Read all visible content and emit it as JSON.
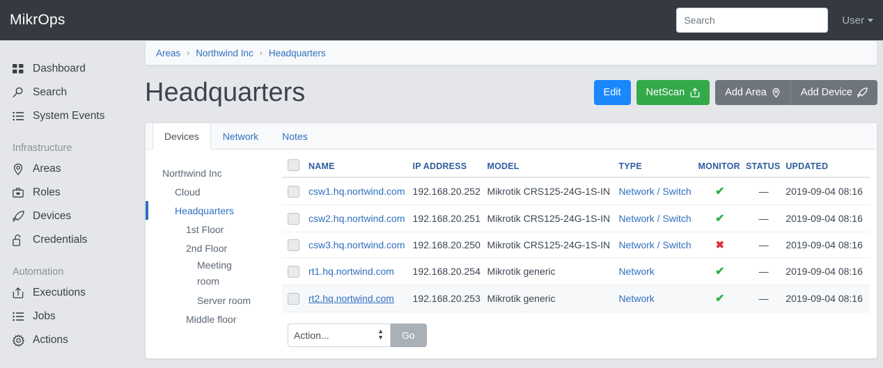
{
  "navbar": {
    "brand": "MikrOps",
    "search_placeholder": "Search",
    "search_value": "",
    "user_label": "User"
  },
  "sidebar": {
    "items": [
      {
        "label": "Dashboard",
        "icon": "grid-icon"
      },
      {
        "label": "Search",
        "icon": "search-icon"
      },
      {
        "label": "System Events",
        "icon": "list-icon"
      }
    ],
    "group_infrastructure": {
      "heading": "Infrastructure",
      "items": [
        {
          "label": "Areas",
          "icon": "map-pin-icon"
        },
        {
          "label": "Roles",
          "icon": "briefcase-icon"
        },
        {
          "label": "Devices",
          "icon": "rocket-icon"
        },
        {
          "label": "Credentials",
          "icon": "lock-open-icon"
        }
      ]
    },
    "group_automation": {
      "heading": "Automation",
      "items": [
        {
          "label": "Executions",
          "icon": "upload-box-icon"
        },
        {
          "label": "Jobs",
          "icon": "list-icon"
        },
        {
          "label": "Actions",
          "icon": "gear-icon"
        }
      ]
    }
  },
  "breadcrumb": {
    "items": [
      "Areas",
      "Northwind Inc",
      "Headquarters"
    ],
    "separator": "›"
  },
  "page": {
    "title": "Headquarters"
  },
  "toolbar": {
    "edit_label": "Edit",
    "netscan_label": "NetScan",
    "add_area_label": "Add Area",
    "add_device_label": "Add Device",
    "colors": {
      "edit": "#1a88fb",
      "netscan": "#34a94a",
      "gray": "#6f757c"
    }
  },
  "tabs": [
    {
      "label": "Devices",
      "active": true
    },
    {
      "label": "Network",
      "active": false
    },
    {
      "label": "Notes",
      "active": false
    }
  ],
  "tree": [
    {
      "label": "Northwind Inc",
      "level": 0,
      "active": false,
      "wrap": false
    },
    {
      "label": "Cloud",
      "level": 1,
      "active": false,
      "wrap": false
    },
    {
      "label": "Headquarters",
      "level": 1,
      "active": true,
      "wrap": false
    },
    {
      "label": "1st Floor",
      "level": 2,
      "active": false,
      "wrap": false
    },
    {
      "label": "2nd Floor",
      "level": 2,
      "active": false,
      "wrap": false
    },
    {
      "label": "Meeting room",
      "level": 3,
      "active": false,
      "wrap": true
    },
    {
      "label": "Server room",
      "level": 3,
      "active": false,
      "wrap": false
    },
    {
      "label": "Middle floor",
      "level": 2,
      "active": false,
      "wrap": false
    }
  ],
  "table": {
    "columns": [
      "NAME",
      "IP ADDRESS",
      "MODEL",
      "TYPE",
      "MONITOR",
      "STATUS",
      "UPDATED"
    ],
    "rows": [
      {
        "name": "csw1.hq.nortwind.com",
        "ip": "192.168.20.252",
        "model": "Mikrotik CRS125-24G-1S-IN",
        "type": "Network / Switch",
        "monitor": "ok",
        "status": "—",
        "updated": "2019-09-04 08:16",
        "hover": false
      },
      {
        "name": "csw2.hq.nortwind.com",
        "ip": "192.168.20.251",
        "model": "Mikrotik CRS125-24G-1S-IN",
        "type": "Network / Switch",
        "monitor": "ok",
        "status": "—",
        "updated": "2019-09-04 08:16",
        "hover": false
      },
      {
        "name": "csw3.hq.nortwind.com",
        "ip": "192.168.20.250",
        "model": "Mikrotik CRS125-24G-1S-IN",
        "type": "Network / Switch",
        "monitor": "bad",
        "status": "—",
        "updated": "2019-09-04 08:16",
        "hover": false
      },
      {
        "name": "rt1.hq.nortwind.com",
        "ip": "192.168.20.254",
        "model": "Mikrotik generic",
        "type": "Network",
        "monitor": "ok",
        "status": "—",
        "updated": "2019-09-04 08:16",
        "hover": false
      },
      {
        "name": "rt2.hq.nortwind.com",
        "ip": "192.168.20.253",
        "model": "Mikrotik generic",
        "type": "Network",
        "monitor": "ok",
        "status": "—",
        "updated": "2019-09-04 08:16",
        "hover": true
      }
    ],
    "monitor_ok_glyph": "✔",
    "monitor_bad_glyph": "✖"
  },
  "action_bar": {
    "select_value": "Action...",
    "go_label": "Go"
  }
}
